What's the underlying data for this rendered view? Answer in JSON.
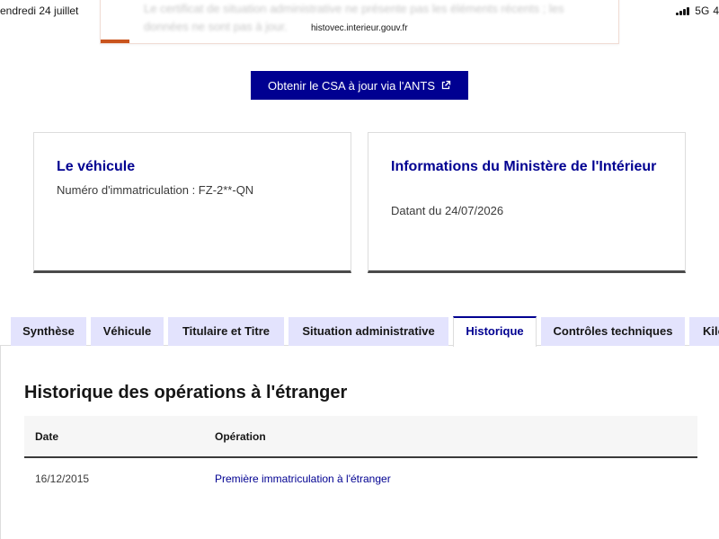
{
  "status_bar": {
    "date": "endredi 24 juillet",
    "network": "5G",
    "battery": "4"
  },
  "browser": {
    "url": "histovec.interieur.gouv.fr"
  },
  "alert": {
    "text": "Le certificat de situation administrative ne présente pas les éléments récents ; les données ne sont pas à jour."
  },
  "csa_button": {
    "label": "Obtenir le CSA à jour via l'ANTS"
  },
  "vehicle_card": {
    "title": "Le véhicule",
    "text": "Numéro d'immatriculation : FZ-2**-QN"
  },
  "ministry_card": {
    "title": "Informations du Ministère de l'Intérieur",
    "text": "Datant du 24/07/2026"
  },
  "tabs": [
    {
      "label": "Synthèse"
    },
    {
      "label": "Véhicule"
    },
    {
      "label": "Titulaire et Titre"
    },
    {
      "label": "Situation administrative"
    },
    {
      "label": "Historique"
    },
    {
      "label": "Contrôles techniques"
    },
    {
      "label": "Kilométrage"
    }
  ],
  "active_tab": "Historique",
  "history": {
    "title": "Historique des opérations à l'étranger",
    "columns": {
      "date": "Date",
      "operation": "Opération"
    },
    "rows": [
      {
        "date": "16/12/2015",
        "operation": "Première immatriculation à l'étranger"
      }
    ]
  },
  "colors": {
    "primary": "#000091",
    "tab_inactive": "#e3e3fd",
    "alert_accent": "#c9541d"
  }
}
